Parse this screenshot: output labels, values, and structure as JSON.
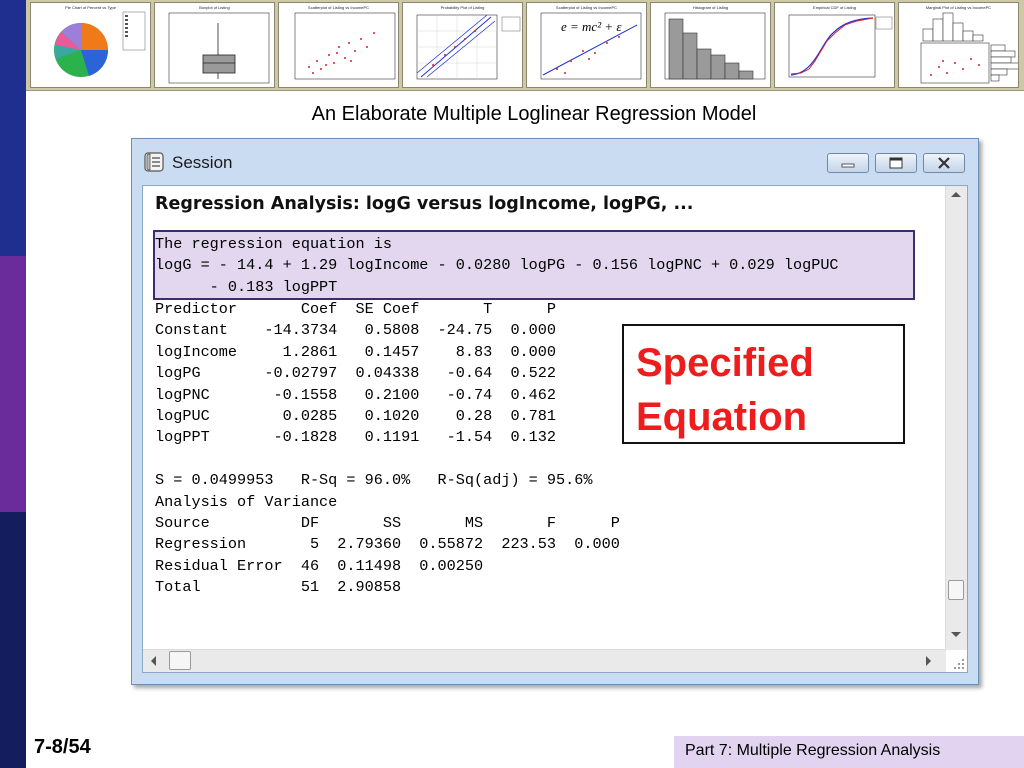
{
  "slide": {
    "title": "An Elaborate Multiple Loglinear Regression Model",
    "page_number": "7-8/54",
    "footer": "Part 7: Multiple Regression Analysis"
  },
  "thumbnails": [
    {
      "title": "Pie Chart of Percent vs Type"
    },
    {
      "title": "Boxplot of Listing"
    },
    {
      "title": "Scatterplot of Listing vs IncomePC"
    },
    {
      "title": "Probability Plot of Listing"
    },
    {
      "title": "Scatterplot of Listing vs IncomePC",
      "formula": "e = mc² + ε"
    },
    {
      "title": "Histogram of Listing"
    },
    {
      "title": "Empirical CDF of Listing"
    },
    {
      "title": "Marginal Plot of Listing vs IncomePC"
    }
  ],
  "window": {
    "title": "Session",
    "heading": "Regression Analysis: logG versus logIncome, logPG, ...",
    "equation_text": "The regression equation is\nlogG = - 14.4 + 1.29 logIncome - 0.0280 logPG - 0.156 logPNC + 0.029 logPUC\n      - 0.183 logPPT",
    "body_text": "Predictor       Coef  SE Coef       T      P\nConstant    -14.3734   0.5808  -24.75  0.000\nlogIncome     1.2861   0.1457    8.83  0.000\nlogPG       -0.02797  0.04338   -0.64  0.522\nlogPNC       -0.1558   0.2100   -0.74  0.462\nlogPUC        0.0285   0.1020    0.28  0.781\nlogPPT       -0.1828   0.1191   -1.54  0.132\n\nS = 0.0499953   R-Sq = 96.0%   R-Sq(adj) = 95.6%\nAnalysis of Variance\nSource          DF       SS       MS       F      P\nRegression       5  2.79360  0.55872  223.53  0.000\nResidual Error  46  0.11498  0.00250\nTotal           51  2.90858"
  },
  "callout": {
    "text": "Specified\nEquation",
    "color": "#ee1c1c"
  },
  "colors": {
    "left_bar_top": "#1f2f8f",
    "left_bar_middle": "#6a2c9a",
    "left_bar_bottom": "#141e5e",
    "equation_highlight": "#e2d7ee",
    "footer_bg": "#e2d4f0"
  }
}
